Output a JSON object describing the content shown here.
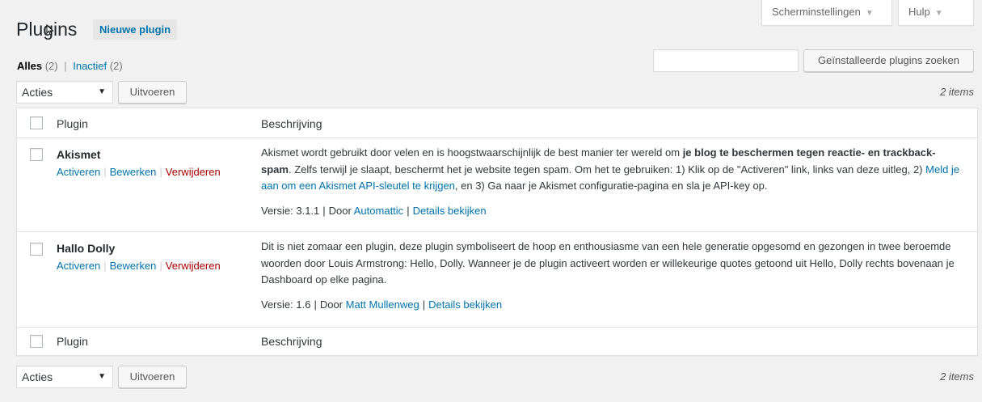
{
  "screen_options": {
    "label": "Scherminstellingen",
    "arrow": "▼"
  },
  "help": {
    "label": "Hulp",
    "arrow": "▼"
  },
  "title": "Plugins",
  "add_new": "Nieuwe plugin",
  "filters": {
    "all_label": "Alles",
    "all_count": "(2)",
    "sep": "|",
    "inactive_label": "Inactief",
    "inactive_count": "(2)"
  },
  "search": {
    "value": "",
    "button": "Geïnstalleerde plugins zoeken"
  },
  "bulk_top": {
    "selected": "Acties",
    "caret": "▼",
    "apply": "Uitvoeren",
    "count": "2 items"
  },
  "bulk_bottom": {
    "selected": "Acties",
    "caret": "▼",
    "apply": "Uitvoeren",
    "count": "2 items"
  },
  "columns": {
    "plugin": "Plugin",
    "description": "Beschrijving"
  },
  "plugins": [
    {
      "name": "Akismet",
      "actions": {
        "activate": "Activeren",
        "edit": "Bewerken",
        "delete": "Verwijderen",
        "sep": "|"
      },
      "desc_1": "Akismet wordt gebruikt door velen en is hoogstwaarschijnlijk de best manier ter wereld om ",
      "desc_bold": "je blog te beschermen tegen reactie- en trackback-spam",
      "desc_2": ". Zelfs terwijl je slaapt, beschermt het je website tegen spam. Om het te gebruiken: 1) Klik op de \"Activeren\" link, links van deze uitleg, 2) ",
      "desc_link": "Meld je aan om een Akismet API-sleutel te krijgen",
      "desc_3": ", en 3) Ga naar je Akismet configuratie-pagina en sla je API-key op.",
      "version": "Versie: 3.1.1",
      "by": "Door",
      "author": "Automattic",
      "details": "Details bekijken",
      "sep": "|"
    },
    {
      "name": "Hallo Dolly",
      "actions": {
        "activate": "Activeren",
        "edit": "Bewerken",
        "delete": "Verwijderen",
        "sep": "|"
      },
      "desc": "Dit is niet zomaar een plugin, deze plugin symboliseert de hoop en enthousiasme van een hele generatie opgesomd en gezongen in twee beroemde woorden door Louis Armstrong: Hello, Dolly. Wanneer je de plugin activeert worden er willekeurige quotes getoond uit Hello, Dolly rechts bovenaan je Dashboard op elke pagina.",
      "version": "Versie: 1.6",
      "by": "Door",
      "author": "Matt Mullenweg",
      "details": "Details bekijken",
      "sep": "|"
    }
  ]
}
